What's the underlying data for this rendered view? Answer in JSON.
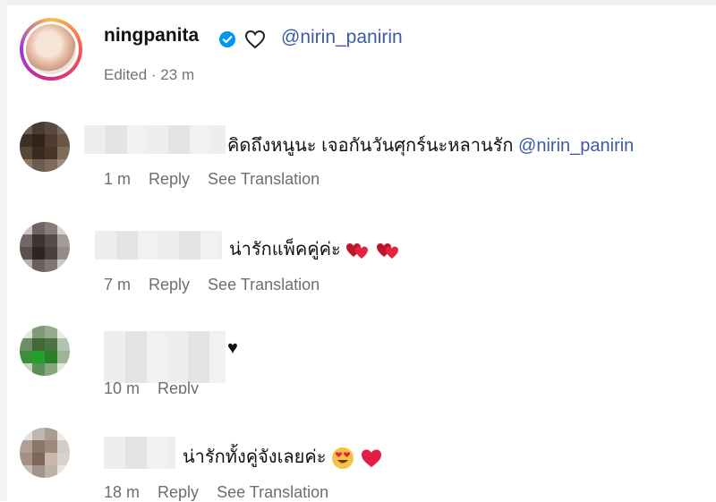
{
  "post": {
    "username": "ningpanita",
    "mention": "@nirin_panirin",
    "edited": "Edited · 23 m"
  },
  "comments": [
    {
      "text": "คิดถึงหนูนะ เจอกันวันศุกร์นะหลานรัก",
      "mention": "@nirin_panirin",
      "time": "1 m",
      "reply": "Reply",
      "translation": "See Translation"
    },
    {
      "text": "น่ารักแพ็คคู่ค่ะ",
      "time": "7 m",
      "reply": "Reply",
      "translation": "See Translation"
    },
    {
      "text": "♥",
      "time": "10 m",
      "reply": "Reply"
    },
    {
      "text": "น่ารักทั้งคู่จังเลยค่ะ",
      "time": "18 m",
      "reply": "Reply",
      "translation": "See Translation"
    }
  ],
  "colors": {
    "mention": "#3b5aa6",
    "verified": "#0095f6",
    "muted": "#737373",
    "heart": "#e11d48"
  },
  "icons": [
    "verified-badge-icon",
    "heart-outline-icon",
    "twin-hearts-emoji",
    "heart-eyes-emoji",
    "red-heart-emoji"
  ]
}
